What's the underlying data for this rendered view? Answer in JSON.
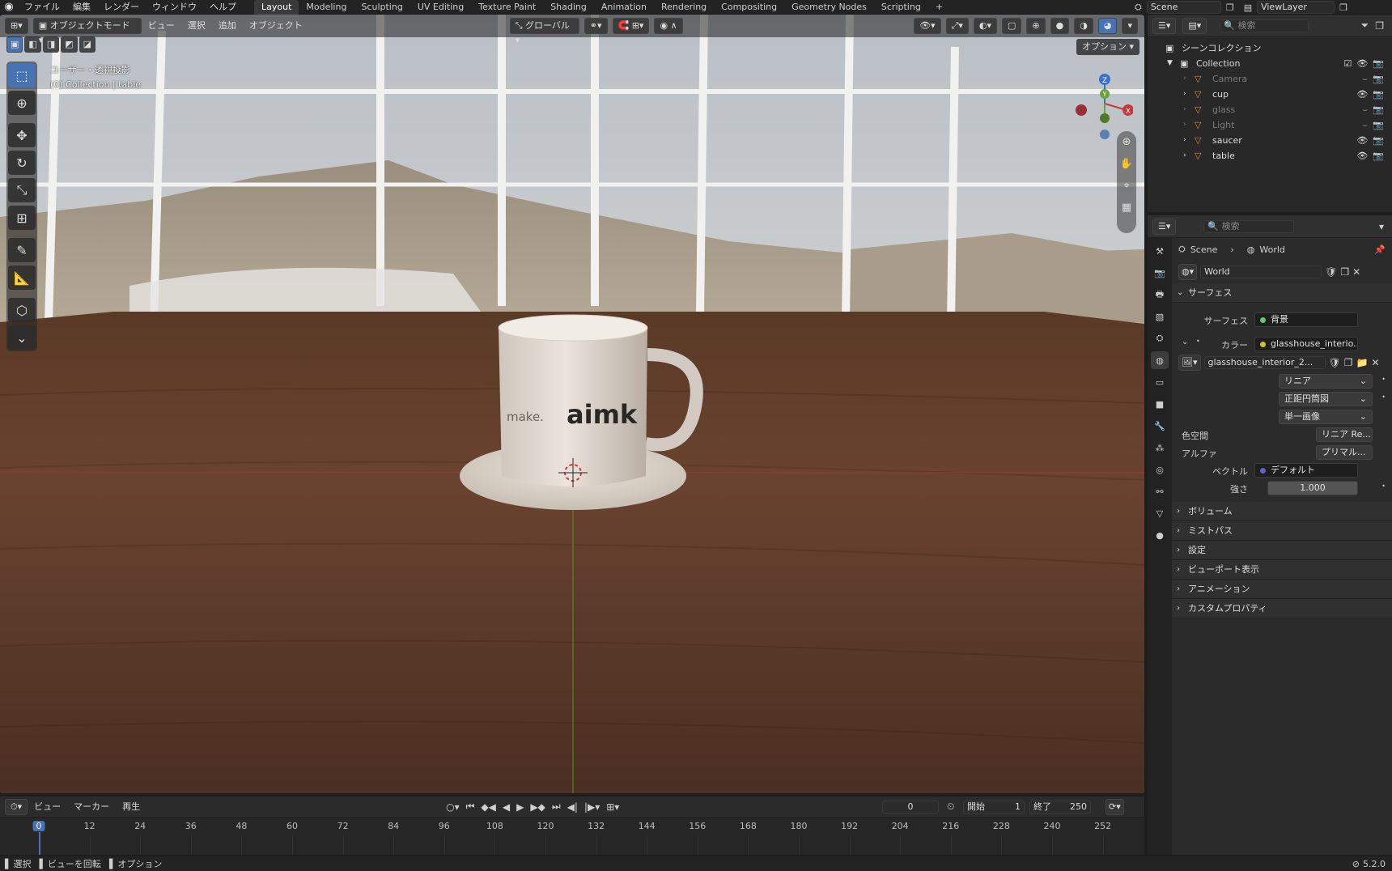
{
  "topbar": {
    "menus": [
      "ファイル",
      "編集",
      "レンダー",
      "ウィンドウ",
      "ヘルプ"
    ],
    "workspaces": [
      "Layout",
      "Modeling",
      "Sculpting",
      "UV Editing",
      "Texture Paint",
      "Shading",
      "Animation",
      "Rendering",
      "Compositing",
      "Geometry Nodes",
      "Scripting"
    ],
    "active_workspace": "Layout",
    "scene": "Scene",
    "view_layer": "ViewLayer"
  },
  "viewport": {
    "mode": "オブジェクトモード",
    "menus": [
      "ビュー",
      "選択",
      "追加",
      "オブジェクト"
    ],
    "transform_orientation": "グローバル",
    "options_label": "オプション",
    "overlay_line1": "ユーザー・透視投影",
    "overlay_line2": "(0) Collection | table",
    "mug_text_left": "make.",
    "mug_text_right": "aimk",
    "gizmo": {
      "z": "Z",
      "y": "Y",
      "x": "X"
    }
  },
  "outliner": {
    "search_placeholder": "検索",
    "root": "シーンコレクション",
    "collection": "Collection",
    "items": [
      {
        "name": "Camera",
        "dim": true
      },
      {
        "name": "cup",
        "dim": false
      },
      {
        "name": "glass",
        "dim": true
      },
      {
        "name": "Light",
        "dim": true
      },
      {
        "name": "saucer",
        "dim": false
      },
      {
        "name": "table",
        "dim": false
      }
    ]
  },
  "properties": {
    "search_placeholder": "検索",
    "breadcrumb_scene": "Scene",
    "breadcrumb_world": "World",
    "world_name": "World",
    "surface_panel": "サーフェス",
    "surface_label": "サーフェス",
    "surface_value": "背景",
    "color_label": "カラー",
    "color_value": "glasshouse_interio...",
    "image_name": "glasshouse_interior_2...",
    "interpolation": "リニア",
    "projection": "正距円筒図",
    "source": "単一画像",
    "colorspace_label": "色空間",
    "colorspace_value": "リニア Re...",
    "alpha_label": "アルファ",
    "alpha_value": "プリマル...",
    "vector_label": "ベクトル",
    "vector_value": "デフォルト",
    "strength_label": "強さ",
    "strength_value": "1.000",
    "panels": [
      "ボリューム",
      "ミストパス",
      "設定",
      "ビューポート表示",
      "アニメーション",
      "カスタムプロパティ"
    ]
  },
  "timeline": {
    "menus": [
      "ビュー",
      "マーカー",
      "再生"
    ],
    "current_frame": "0",
    "start_label": "開始",
    "start_value": "1",
    "end_label": "終了",
    "end_value": "250",
    "ticks": [
      "0",
      "12",
      "24",
      "36",
      "48",
      "60",
      "72",
      "84",
      "96",
      "108",
      "120",
      "132",
      "144",
      "156",
      "168",
      "180",
      "192",
      "204",
      "216",
      "228",
      "240",
      "252"
    ]
  },
  "statusbar": {
    "select": "選択",
    "rotate_view": "ビューを回転",
    "options": "オプション",
    "version": "5.2.0"
  }
}
